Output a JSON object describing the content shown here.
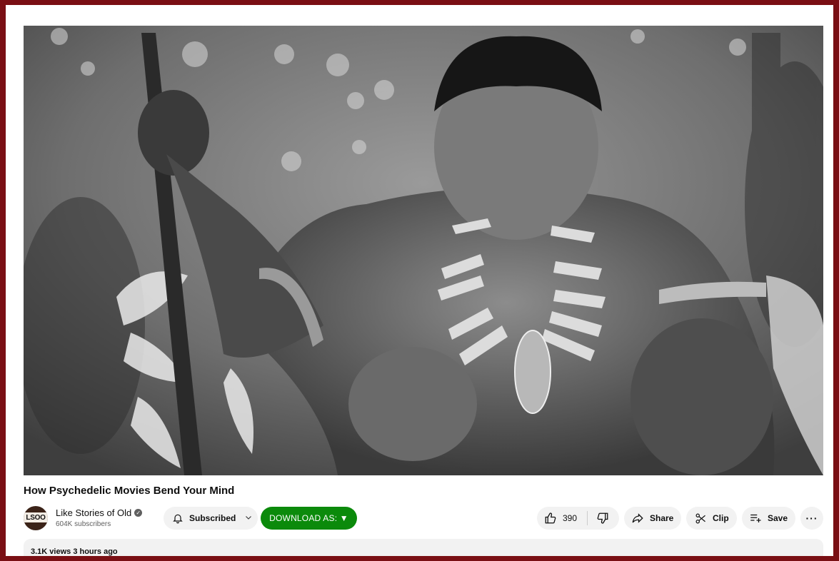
{
  "video": {
    "thumbnail_icon": "jungle-warrior-photo"
  },
  "title": "How Psychedelic Movies Bend Your Mind",
  "channel": {
    "avatar_text": "LSOO",
    "name": "Like Stories of Old",
    "verified_icon": "verified-check-icon",
    "subscribers": "604K subscribers"
  },
  "actions": {
    "subscribed_label": "Subscribed",
    "download_label": "DOWNLOAD AS: ▼",
    "like_count": "390",
    "share_label": "Share",
    "clip_label": "Clip",
    "save_label": "Save",
    "more_label": "···"
  },
  "description": {
    "meta": "3.1K views  3 hours ago"
  },
  "colors": {
    "frame": "#7a0f14",
    "download": "#0b8a0b",
    "pill": "#f2f2f2"
  }
}
